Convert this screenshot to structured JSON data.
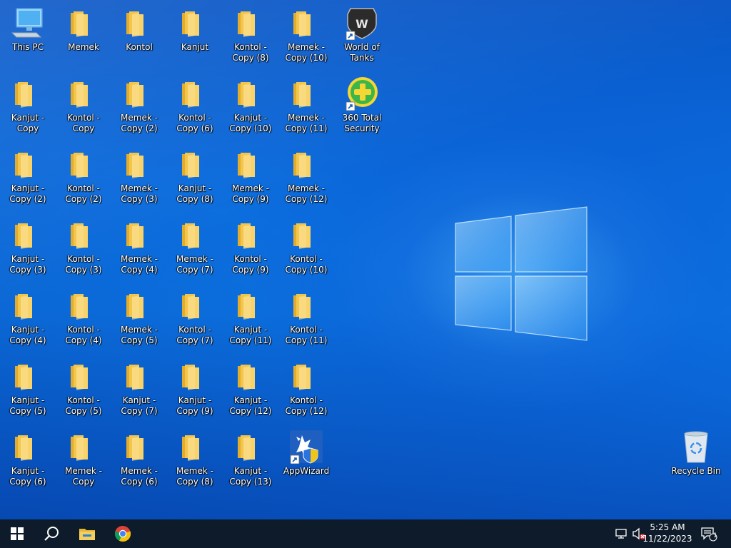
{
  "desktop": {
    "icons": [
      {
        "label": "This PC",
        "type": "pc"
      },
      {
        "label": "Memek",
        "type": "folder"
      },
      {
        "label": "Kontol",
        "type": "folder"
      },
      {
        "label": "Kanjut",
        "type": "folder"
      },
      {
        "label": "Kontol - Copy (8)",
        "type": "folder"
      },
      {
        "label": "Memek - Copy (10)",
        "type": "folder"
      },
      {
        "label": "World of Tanks",
        "type": "wot"
      },
      {
        "label": "Kanjut - Copy",
        "type": "folder"
      },
      {
        "label": "Kontol - Copy",
        "type": "folder"
      },
      {
        "label": "Memek - Copy (2)",
        "type": "folder"
      },
      {
        "label": "Kontol - Copy (6)",
        "type": "folder"
      },
      {
        "label": "Kanjut - Copy (10)",
        "type": "folder"
      },
      {
        "label": "Memek - Copy (11)",
        "type": "folder"
      },
      {
        "label": "360 Total Security",
        "type": "security"
      },
      {
        "label": "Kanjut - Copy (2)",
        "type": "folder"
      },
      {
        "label": "Kontol - Copy (2)",
        "type": "folder"
      },
      {
        "label": "Memek - Copy (3)",
        "type": "folder"
      },
      {
        "label": "Kanjut - Copy (8)",
        "type": "folder"
      },
      {
        "label": "Memek - Copy (9)",
        "type": "folder"
      },
      {
        "label": "Memek - Copy (12)",
        "type": "folder"
      },
      {
        "label": "Kanjut - Copy (3)",
        "type": "folder"
      },
      {
        "label": "Kontol - Copy (3)",
        "type": "folder"
      },
      {
        "label": "Memek - Copy (4)",
        "type": "folder"
      },
      {
        "label": "Memek - Copy (7)",
        "type": "folder"
      },
      {
        "label": "Kontol - Copy (9)",
        "type": "folder"
      },
      {
        "label": "Kontol - Copy (10)",
        "type": "folder"
      },
      {
        "label": "Kanjut - Copy (4)",
        "type": "folder"
      },
      {
        "label": "Kontol - Copy (4)",
        "type": "folder"
      },
      {
        "label": "Memek - Copy (5)",
        "type": "folder"
      },
      {
        "label": "Kontol - Copy (7)",
        "type": "folder"
      },
      {
        "label": "Kanjut - Copy (11)",
        "type": "folder"
      },
      {
        "label": "Kontol - Copy (11)",
        "type": "folder"
      },
      {
        "label": "Kanjut - Copy (5)",
        "type": "folder"
      },
      {
        "label": "Kontol - Copy (5)",
        "type": "folder"
      },
      {
        "label": "Kanjut - Copy (7)",
        "type": "folder"
      },
      {
        "label": "Kanjut - Copy (9)",
        "type": "folder"
      },
      {
        "label": "Kanjut - Copy (12)",
        "type": "folder"
      },
      {
        "label": "Kontol - Copy (12)",
        "type": "folder"
      },
      {
        "label": "Kanjut - Copy (6)",
        "type": "folder"
      },
      {
        "label": "Memek - Copy",
        "type": "folder"
      },
      {
        "label": "Memek - Copy (6)",
        "type": "folder"
      },
      {
        "label": "Memek - Copy (8)",
        "type": "folder"
      },
      {
        "label": "Kanjut - Copy (13)",
        "type": "folder"
      },
      {
        "label": "AppWizard",
        "type": "appwizard"
      },
      {
        "label": "Recycle Bin",
        "type": "recycle"
      }
    ]
  },
  "taskbar": {
    "start_icon": "windows-logo-icon",
    "search_icon": "search-icon",
    "pinned": [
      {
        "name": "file-explorer-icon"
      },
      {
        "name": "chrome-icon"
      }
    ],
    "tray": {
      "network_icon": "network-icon",
      "volume_icon": "volume-muted-icon",
      "time": "5:25 AM",
      "date": "11/22/2023",
      "notification_icon": "notification-icon",
      "notification_count": "1"
    }
  },
  "colors": {
    "folder": "#f5c84c",
    "taskbar": "#0d1b2a",
    "wallpaper": "#0b6bdc"
  }
}
